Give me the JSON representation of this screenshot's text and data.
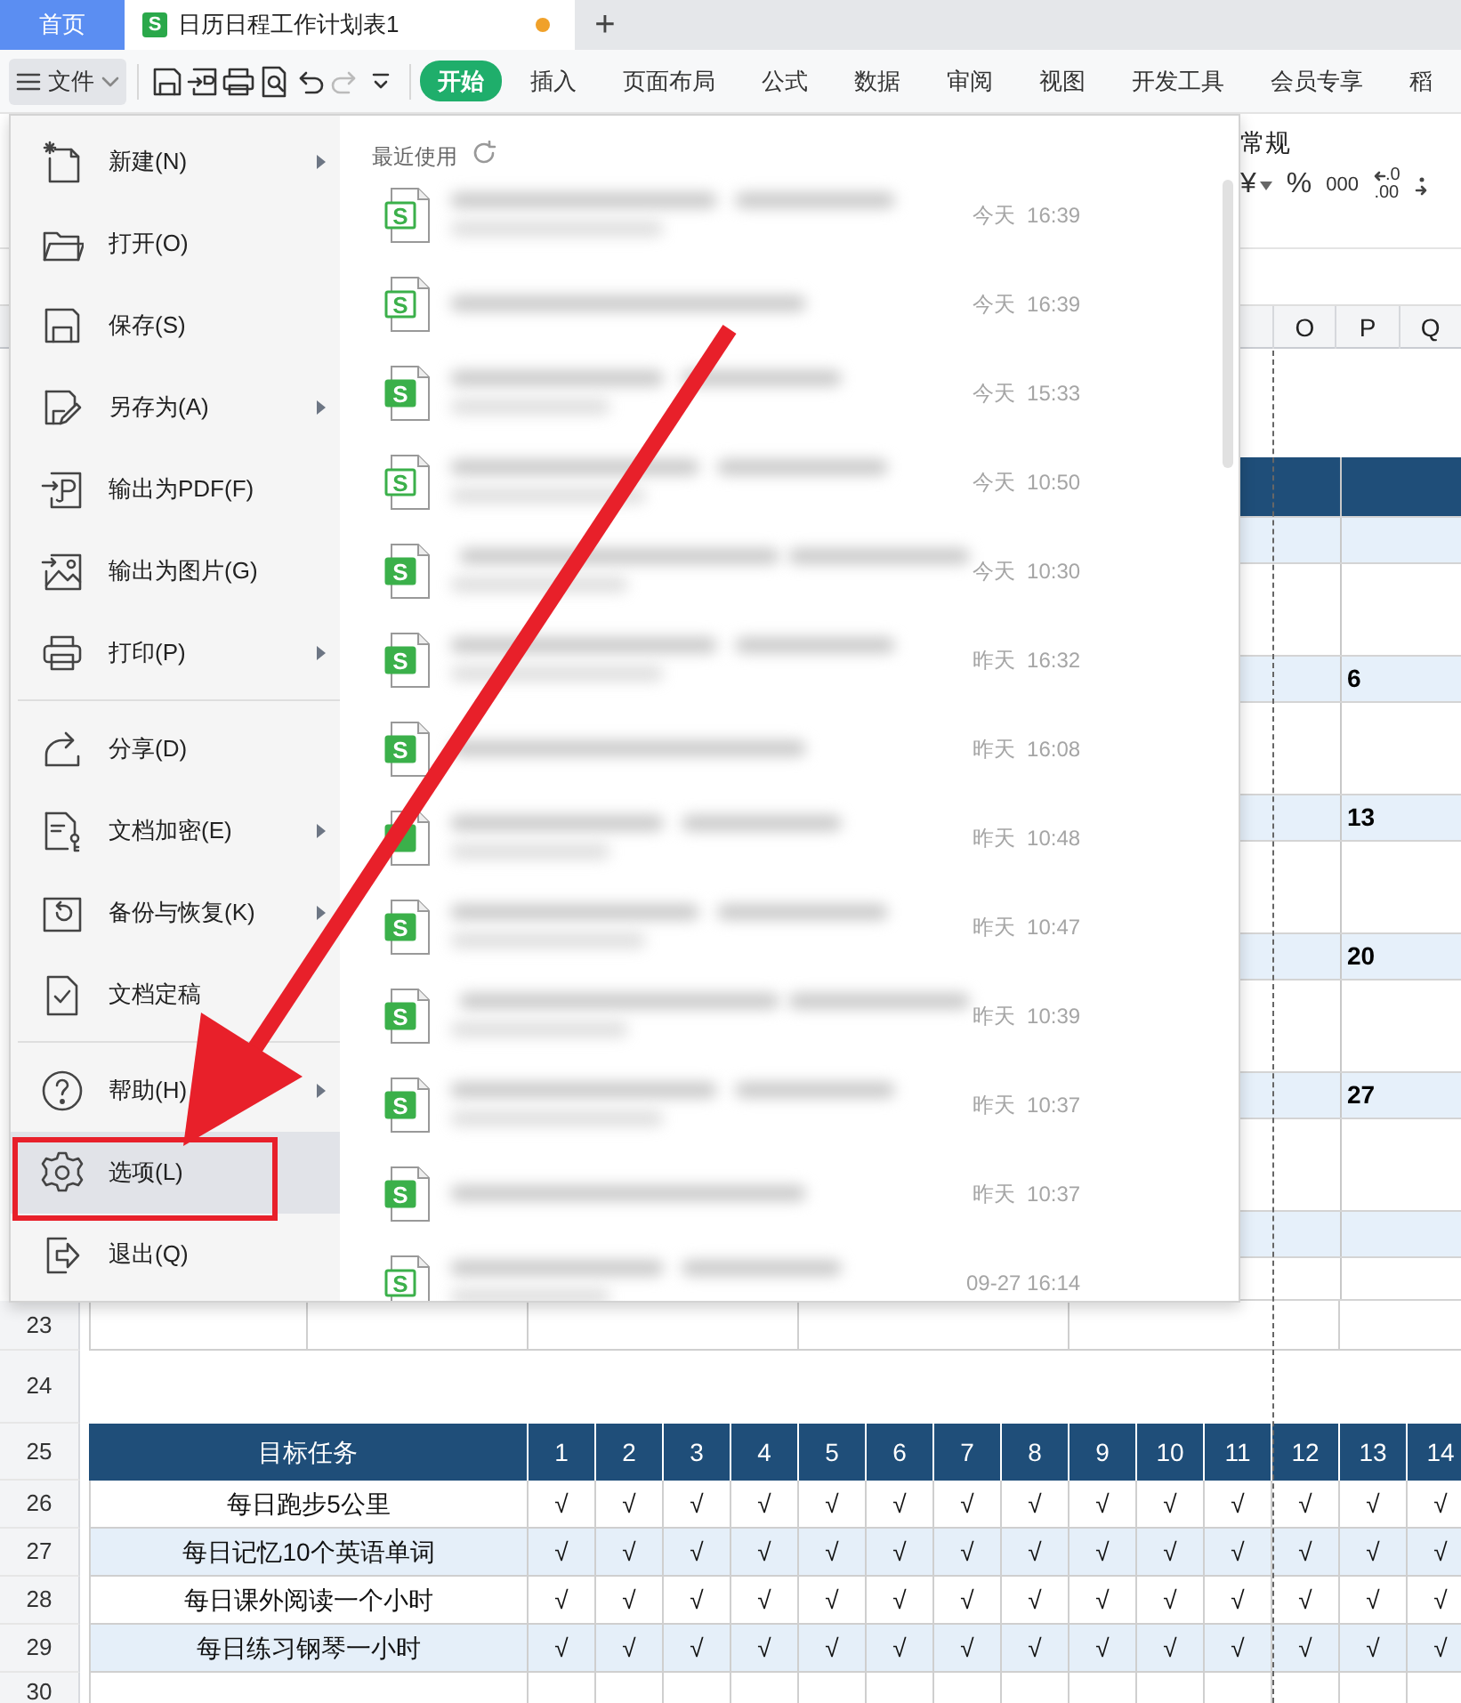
{
  "tabs": [
    {
      "label": "首页",
      "kind": "home",
      "selected": false
    },
    {
      "label": "日历日程工作计划表1",
      "kind": "document",
      "badge": "S",
      "selected": true,
      "modified": true
    }
  ],
  "new_tab": "+",
  "toolbar": {
    "file_button": {
      "label": "文件",
      "expanded": true
    },
    "quick_actions": [
      {
        "kind": "save",
        "disabled": false
      },
      {
        "kind": "export",
        "disabled": false
      },
      {
        "kind": "print",
        "disabled": false
      },
      {
        "kind": "preview",
        "disabled": false
      },
      {
        "kind": "undo",
        "disabled": false
      },
      {
        "kind": "redo",
        "disabled": true
      },
      {
        "kind": "more",
        "disabled": false
      }
    ],
    "ribbon_tabs": [
      {
        "label": "开始",
        "selected": true
      },
      {
        "label": "插入",
        "selected": false
      },
      {
        "label": "页面布局",
        "selected": false
      },
      {
        "label": "公式",
        "selected": false
      },
      {
        "label": "数据",
        "selected": false
      },
      {
        "label": "审阅",
        "selected": false
      },
      {
        "label": "视图",
        "selected": false
      },
      {
        "label": "开发工具",
        "selected": false
      },
      {
        "label": "会员专享",
        "selected": false
      },
      {
        "label": "稻",
        "selected": false
      }
    ]
  },
  "ribbon": {
    "number_format": "常规",
    "buttons": [
      {
        "kind": "currency",
        "label": "¥"
      },
      {
        "kind": "percent",
        "label": "%"
      },
      {
        "kind": "thousands",
        "label": "000"
      },
      {
        "kind": "decrease-decimal",
        "top": ".0",
        "bottom": ".00"
      },
      {
        "kind": "increase-decimal"
      }
    ]
  },
  "column_headers": [
    "O",
    "P",
    "Q"
  ],
  "calendar_rows": [
    {
      "kind": "blank"
    },
    {
      "kind": "header"
    },
    {
      "kind": "shade"
    },
    {
      "kind": "plain"
    },
    {
      "kind": "shade",
      "value": "6"
    },
    {
      "kind": "plain"
    },
    {
      "kind": "shade",
      "value": "13"
    },
    {
      "kind": "plain"
    },
    {
      "kind": "shade",
      "value": "20"
    },
    {
      "kind": "plain"
    },
    {
      "kind": "shade",
      "value": "27"
    },
    {
      "kind": "plain"
    },
    {
      "kind": "shade"
    },
    {
      "kind": "tail"
    }
  ],
  "sheet_rows": [
    {
      "number": "23",
      "kind": "grid"
    },
    {
      "number": "24",
      "kind": "gap"
    },
    {
      "number": "25",
      "kind": "header",
      "task": "目标任务",
      "cells": [
        "1",
        "2",
        "3",
        "4",
        "5",
        "6",
        "7",
        "8",
        "9",
        "10",
        "11",
        "12",
        "13",
        "14"
      ]
    },
    {
      "number": "26",
      "kind": "task",
      "shaded": false,
      "task": "每日跑步5公里",
      "cells": [
        "√",
        "√",
        "√",
        "√",
        "√",
        "√",
        "√",
        "√",
        "√",
        "√",
        "√",
        "√",
        "√",
        "√"
      ]
    },
    {
      "number": "27",
      "kind": "task",
      "shaded": true,
      "task": "每日记忆10个英语单词",
      "cells": [
        "√",
        "√",
        "√",
        "√",
        "√",
        "√",
        "√",
        "√",
        "√",
        "√",
        "√",
        "√",
        "√",
        "√"
      ]
    },
    {
      "number": "28",
      "kind": "task",
      "shaded": false,
      "task": "每日课外阅读一个小时",
      "cells": [
        "√",
        "√",
        "√",
        "√",
        "√",
        "√",
        "√",
        "√",
        "√",
        "√",
        "√",
        "√",
        "√",
        "√"
      ]
    },
    {
      "number": "29",
      "kind": "task",
      "shaded": true,
      "task": "每日练习钢琴一小时",
      "cells": [
        "√",
        "√",
        "√",
        "√",
        "√",
        "√",
        "√",
        "√",
        "√",
        "√",
        "√",
        "√",
        "√",
        "√"
      ]
    },
    {
      "number": "30",
      "kind": "blank"
    }
  ],
  "file_menu": {
    "groups": [
      [
        {
          "label": "新建(N)",
          "kind": "new",
          "submenu": true,
          "highlighted": false
        },
        {
          "label": "打开(O)",
          "kind": "open",
          "submenu": false,
          "highlighted": false
        },
        {
          "label": "保存(S)",
          "kind": "save",
          "submenu": false,
          "highlighted": false
        },
        {
          "label": "另存为(A)",
          "kind": "saveas",
          "submenu": true,
          "highlighted": false
        },
        {
          "label": "输出为PDF(F)",
          "kind": "pdf",
          "submenu": false,
          "highlighted": false
        },
        {
          "label": "输出为图片(G)",
          "kind": "image",
          "submenu": false,
          "highlighted": false
        },
        {
          "label": "打印(P)",
          "kind": "print",
          "submenu": true,
          "highlighted": false
        }
      ],
      [
        {
          "label": "分享(D)",
          "kind": "share",
          "submenu": false,
          "highlighted": false
        },
        {
          "label": "文档加密(E)",
          "kind": "encrypt",
          "submenu": true,
          "highlighted": false
        },
        {
          "label": "备份与恢复(K)",
          "kind": "backup",
          "submenu": true,
          "highlighted": false
        },
        {
          "label": "文档定稿",
          "kind": "finalize",
          "submenu": false,
          "highlighted": false
        }
      ],
      [
        {
          "label": "帮助(H)",
          "kind": "help",
          "submenu": true,
          "highlighted": false
        },
        {
          "label": "选项(L)",
          "kind": "options",
          "submenu": false,
          "highlighted": true
        },
        {
          "label": "退出(Q)",
          "kind": "exit",
          "submenu": false,
          "highlighted": false
        }
      ]
    ],
    "recent": {
      "title": "最近使用",
      "files": [
        {
          "time": "今天  16:39",
          "badge": "S",
          "kind": "outline"
        },
        {
          "time": "今天  16:39",
          "badge": "S",
          "kind": "outline"
        },
        {
          "time": "今天  15:33",
          "badge": "S",
          "kind": "filled"
        },
        {
          "time": "今天  10:50",
          "badge": "S",
          "kind": "outline"
        },
        {
          "time": "今天  10:30",
          "badge": "S",
          "kind": "filled"
        },
        {
          "time": "昨天  16:32",
          "badge": "S",
          "kind": "filled"
        },
        {
          "time": "昨天  16:08",
          "badge": "S",
          "kind": "filled"
        },
        {
          "time": "昨天  10:48",
          "kind": "filled"
        },
        {
          "time": "昨天  10:47",
          "badge": "S",
          "kind": "filled"
        },
        {
          "time": "昨天  10:39",
          "badge": "S",
          "kind": "filled"
        },
        {
          "time": "昨天  10:37",
          "badge": "S",
          "kind": "filled"
        },
        {
          "time": "昨天  10:37",
          "badge": "S",
          "kind": "filled"
        },
        {
          "time": "09-27 16:14",
          "badge": "S",
          "kind": "outline"
        }
      ]
    }
  }
}
